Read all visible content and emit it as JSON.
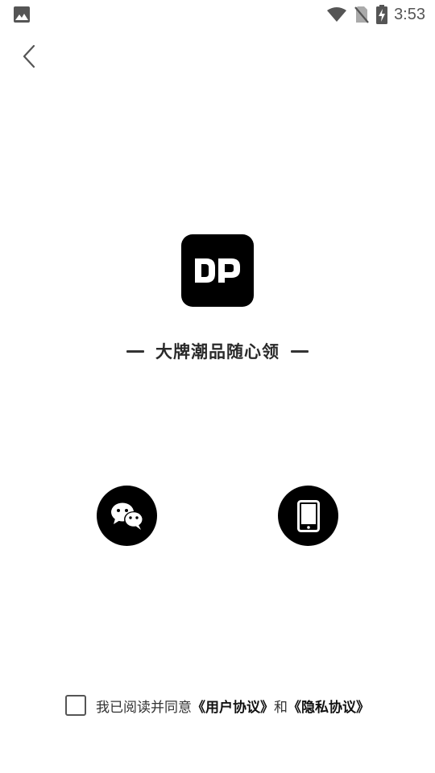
{
  "status_bar": {
    "time": "3:53",
    "icons": [
      "photo-icon",
      "wifi-icon",
      "no-sim-icon",
      "battery-charging-icon"
    ]
  },
  "nav": {
    "back_icon": "chevron-left-icon"
  },
  "brand": {
    "logo_text": "DP",
    "logo_background": "#000000",
    "slogan": "大牌潮品随心领"
  },
  "login_options": [
    {
      "name": "wechat",
      "icon": "wechat-icon",
      "background": "#000000"
    },
    {
      "name": "phone",
      "icon": "phone-icon",
      "background": "#000000"
    }
  ],
  "agreement": {
    "checked": false,
    "prefix": "我已阅读并同意",
    "user_agreement": "《用户协议》",
    "conjunction": "和",
    "privacy_policy": "《隐私协议》"
  }
}
